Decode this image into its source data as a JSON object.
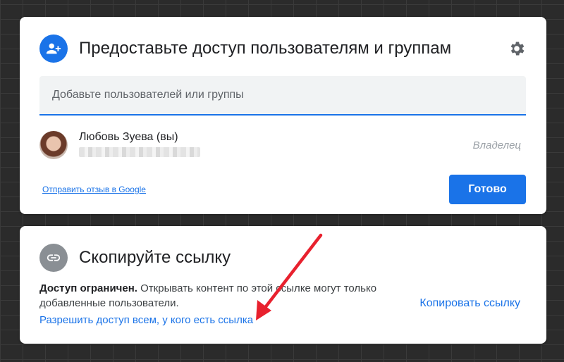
{
  "share_panel": {
    "title": "Предоставьте доступ пользователям и группам",
    "search_placeholder": "Добавьте пользователей или группы",
    "user": {
      "name": "Любовь Зуева (вы)",
      "role": "Владелец"
    },
    "feedback_link": "Отправить отзыв в Google",
    "done_button": "Готово",
    "icons": {
      "header": "add-person-icon",
      "settings": "gear-icon"
    }
  },
  "link_panel": {
    "title": "Скопируйте ссылку",
    "access_bold": "Доступ ограничен.",
    "access_text": " Открывать контент по этой ссылке могут только добавленные пользователи.",
    "allow_link": "Разрешить доступ всем, у кого есть ссылка",
    "copy_link": "Копировать ссылку",
    "icons": {
      "header": "link-icon"
    }
  },
  "colors": {
    "accent": "#1a73e8",
    "annotation_arrow": "#e8212e",
    "background": "#2b2b2b"
  }
}
